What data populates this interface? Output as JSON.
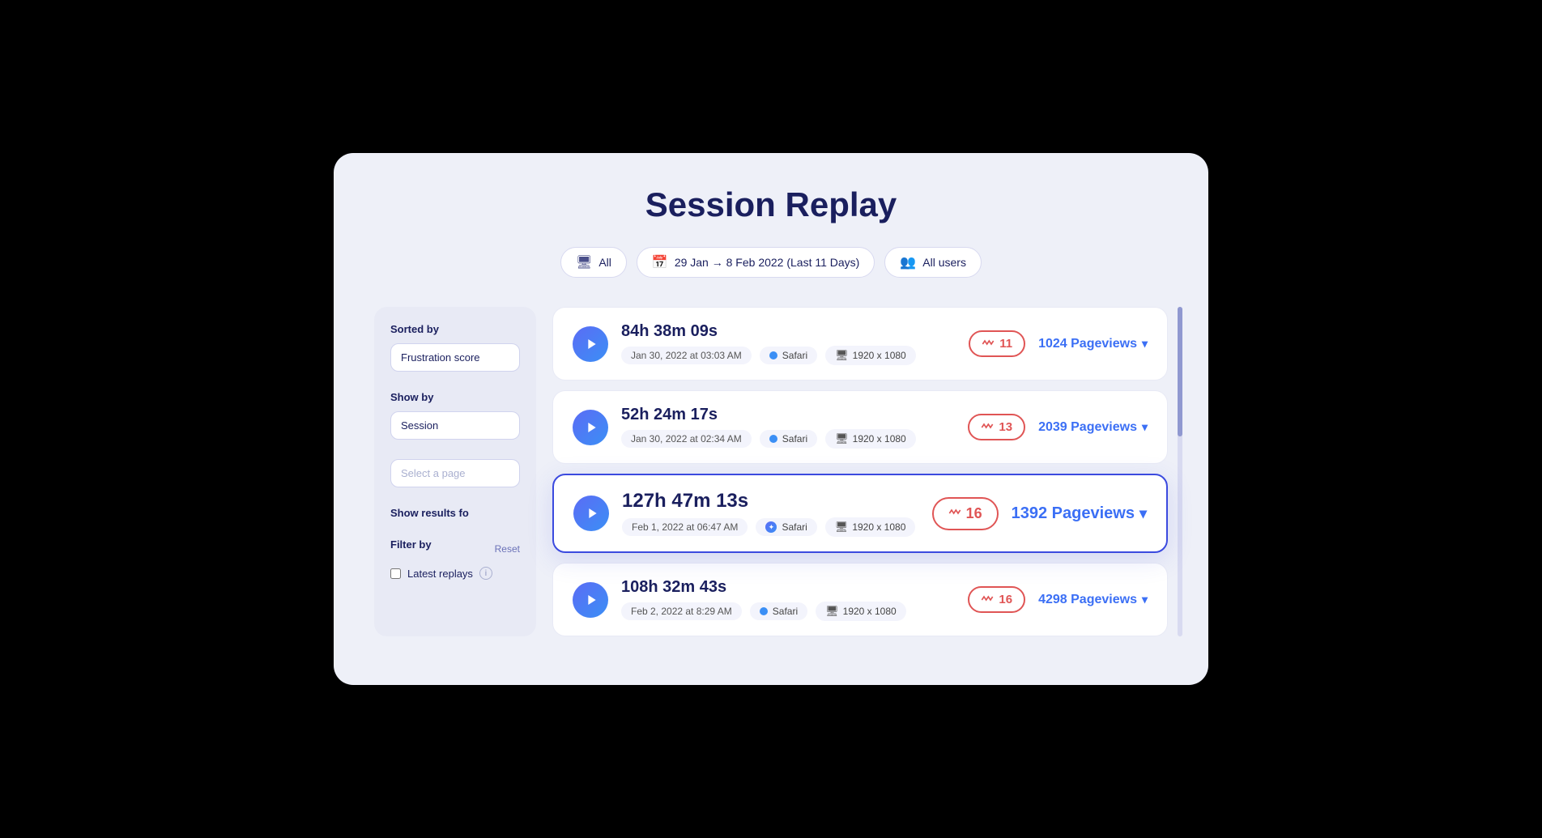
{
  "page": {
    "title": "Session Replay"
  },
  "filters": {
    "device_label": "All",
    "date_range": "29 Jan → 8 Feb 2022 (Last 11 Days)",
    "users": "All users"
  },
  "sidebar": {
    "sorted_by_label": "Sorted by",
    "sorted_by_value": "Frustration score",
    "show_by_label": "Show by",
    "show_by_value": "Session",
    "page_placeholder": "Select a page",
    "show_results_label": "Show results fo",
    "filter_by_label": "Filter by",
    "reset_label": "Reset",
    "latest_replays_label": "Latest replays"
  },
  "sessions": [
    {
      "duration": "84h 38m 09s",
      "date": "Jan 30, 2022 at 03:03 AM",
      "browser": "Safari",
      "resolution": "1920 x 1080",
      "frustration": 11,
      "pageviews": "1024 Pageviews",
      "highlighted": false
    },
    {
      "duration": "52h 24m 17s",
      "date": "Jan 30, 2022 at 02:34 AM",
      "browser": "Safari",
      "resolution": "1920 x 1080",
      "frustration": 13,
      "pageviews": "2039 Pageviews",
      "highlighted": false
    },
    {
      "duration": "127h 47m 13s",
      "date": "Feb 1, 2022 at 06:47 AM",
      "browser": "Safari",
      "resolution": "1920 x 1080",
      "frustration": 16,
      "pageviews": "1392 Pageviews",
      "highlighted": true
    },
    {
      "duration": "108h 32m 43s",
      "date": "Feb 2, 2022 at 8:29 AM",
      "browser": "Safari",
      "resolution": "1920 x 1080",
      "frustration": 16,
      "pageviews": "4298 Pageviews",
      "highlighted": false
    }
  ]
}
